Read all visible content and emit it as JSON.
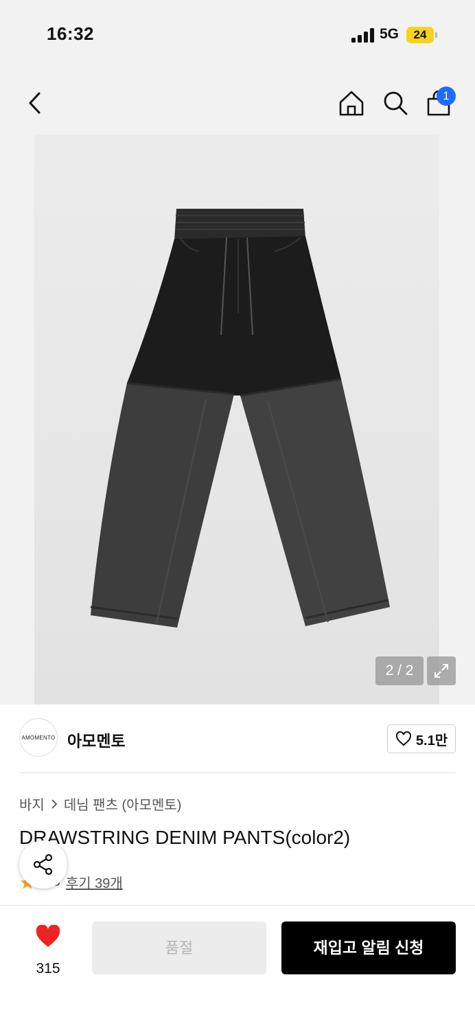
{
  "status_bar": {
    "time": "16:32",
    "network": "5G",
    "battery": "24"
  },
  "nav": {
    "cart_count": "1",
    "icons": [
      "back-arrow-icon",
      "home-icon",
      "search-icon",
      "shopping-bag-icon"
    ]
  },
  "gallery": {
    "pager": "2 / 2",
    "icons": [
      "expand-icon"
    ]
  },
  "brand": {
    "logo_text": "AMOMENTO",
    "name": "아모멘토",
    "likes": "5.1만"
  },
  "product": {
    "breadcrumb": [
      "바지",
      "데님 팬츠 (아모멘토)"
    ],
    "title": "DRAWSTRING DENIM PANTS(color2)",
    "rating": "4.8",
    "reviews": "후기 39개"
  },
  "bottom_bar": {
    "wish_count": "315",
    "soldout_label": "품절",
    "restock_label": "재입고 알림 신청"
  },
  "colors": {
    "badge": "#1f6bff",
    "battery": "#f7d21e",
    "heart": "#f02323",
    "star": "#f5a623"
  }
}
